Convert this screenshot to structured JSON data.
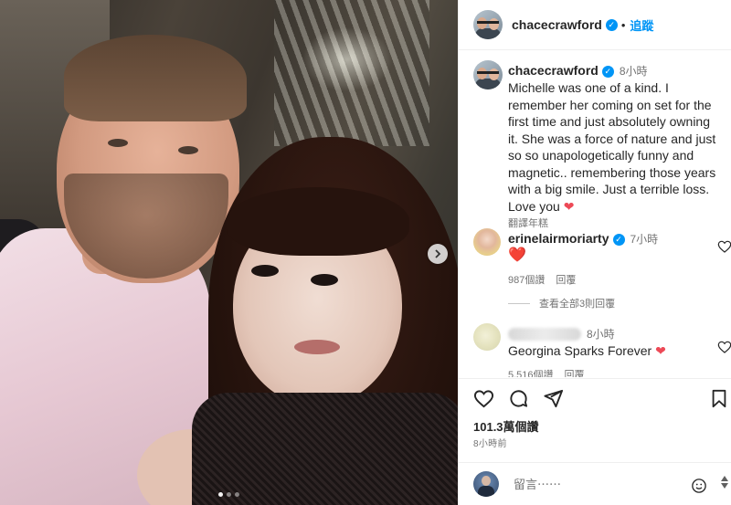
{
  "post": {
    "author": "chacecrawford",
    "follow_label": "追蹤",
    "separator": "•",
    "caption": {
      "time": "8小時",
      "text_lines": [
        "Michelle was one of a kind. I",
        "remember her coming on set for the",
        "first time and just absolutely owning",
        "it. She was a force of nature and just",
        "so so unapologetically funny and",
        "magnetic.. remembering those years",
        "with a big smile. Just a terrible loss.",
        "Love you"
      ],
      "translate_label": "翻譯年糕"
    },
    "likes_label": "101.3萬個讚",
    "post_time": "8小時前",
    "image_carousel": {
      "current": 1,
      "total": 3
    }
  },
  "comments": [
    {
      "username": "erinelairmoriarty",
      "verified": true,
      "time": "7小時",
      "text": "❤️",
      "likes": "987個讚",
      "reply_label": "回覆"
    },
    {
      "username": "",
      "blurred": true,
      "time": "8小時",
      "text": "Georgina Sparks Forever",
      "likes": "5,516個讚",
      "reply_label": "回覆"
    }
  ],
  "view_replies_label": "查看全部3則回覆",
  "add_comment": {
    "placeholder": "留言⋯⋯"
  },
  "icons": {
    "verified": "verified-badge-icon",
    "like": "heart-icon",
    "comment": "comment-icon",
    "share": "paper-plane-icon",
    "save": "bookmark-icon",
    "next": "chevron-right-icon",
    "emoji": "smiley-icon"
  },
  "colors": {
    "accent": "#0095f6",
    "heart": "#ed4956",
    "muted": "#737373"
  }
}
